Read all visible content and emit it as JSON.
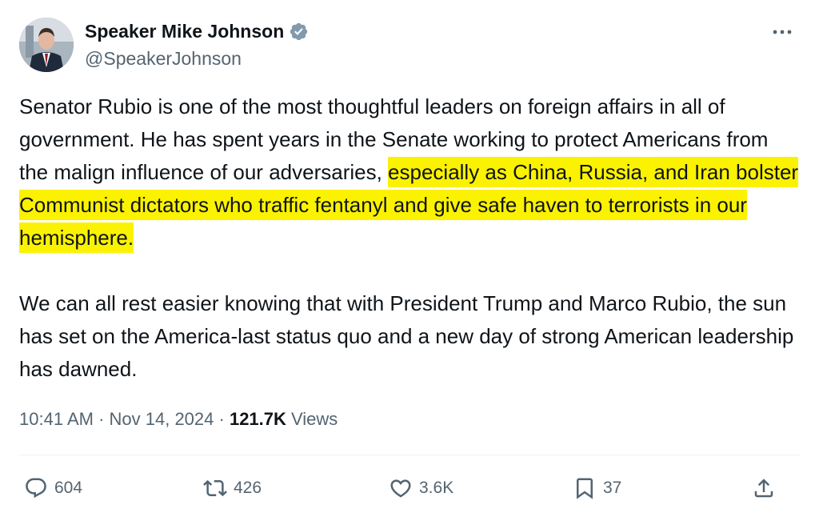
{
  "author": {
    "name": "Speaker Mike Johnson",
    "handle": "@SpeakerJohnson",
    "verified_color": "#829aab"
  },
  "tweet": {
    "p1_before": "Senator Rubio is one of the most thoughtful leaders on foreign affairs in all of government. He has spent years in the Senate working to protect Americans from the malign influence of our adversaries, ",
    "p1_highlight": "especially as China, Russia, and Iran bolster Communist dictators who traffic fentanyl and give safe haven to terrorists in our hemisphere.",
    "p2": "We can all rest easier knowing that with President Trump and Marco Rubio, the sun has set on the America-last status quo and a new day of strong American leadership has dawned.",
    "highlight_color": "#fbf200"
  },
  "meta": {
    "time": "10:41 AM",
    "sep1": " · ",
    "date": "Nov 14, 2024",
    "sep2": " · ",
    "views_count": "121.7K",
    "views_label": " Views"
  },
  "actions": {
    "replies": "604",
    "reposts": "426",
    "likes": "3.6K",
    "bookmarks": "37"
  },
  "icons": [
    "verified-badge-icon",
    "more-icon",
    "reply-icon",
    "repost-icon",
    "like-icon",
    "bookmark-icon",
    "share-icon"
  ]
}
